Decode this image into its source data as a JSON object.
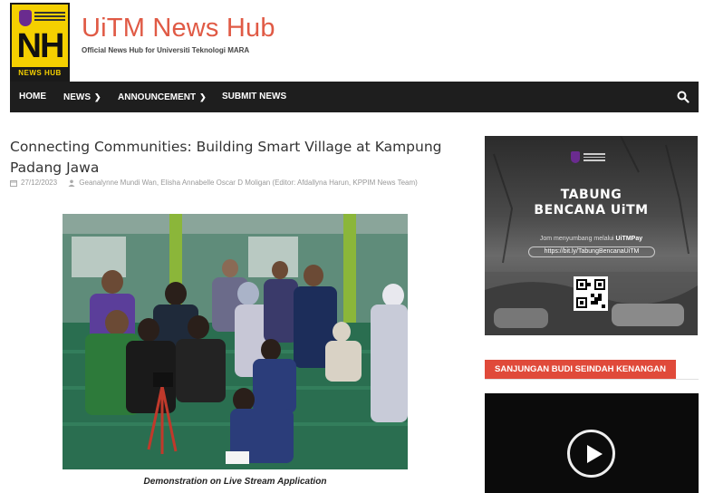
{
  "brand": {
    "logo_text": "NH",
    "logo_band": "NEWS HUB",
    "site_title": "UiTM News Hub",
    "tagline": "Official News Hub for Universiti Teknologi MARA"
  },
  "nav": {
    "items": [
      {
        "label": "HOME",
        "has_dropdown": false
      },
      {
        "label": "NEWS",
        "has_dropdown": true
      },
      {
        "label": "ANNOUNCEMENT",
        "has_dropdown": true
      },
      {
        "label": "SUBMIT NEWS",
        "has_dropdown": false
      }
    ],
    "search_icon": "search-icon"
  },
  "article": {
    "title": "Connecting Communities: Building Smart Village at Kampung Padang Jawa",
    "date": "27/12/2023",
    "authors": "Geanalynne Mundi Wan, Elisha Annabelle Oscar D Moligan (Editor: Afdallyna Harun, KPPIM News Team)",
    "caption": "Demonstration on Live Stream Application"
  },
  "sidebar": {
    "banner": {
      "title_line1": "TABUNG",
      "title_line2": "BENCANA UiTM",
      "sub_prefix": "Jom menyumbang melalui ",
      "sub_bold": "UiTMPay",
      "link": "https://bit.ly/TabungBencanaUiTM"
    },
    "section_title": "SANJUNGAN BUDI SEINDAH KENANGAN"
  },
  "colors": {
    "accent": "#e05a45",
    "nav_bg": "#1e1e1e",
    "logo_yellow": "#f5d000",
    "section_red": "#e04a3a"
  }
}
